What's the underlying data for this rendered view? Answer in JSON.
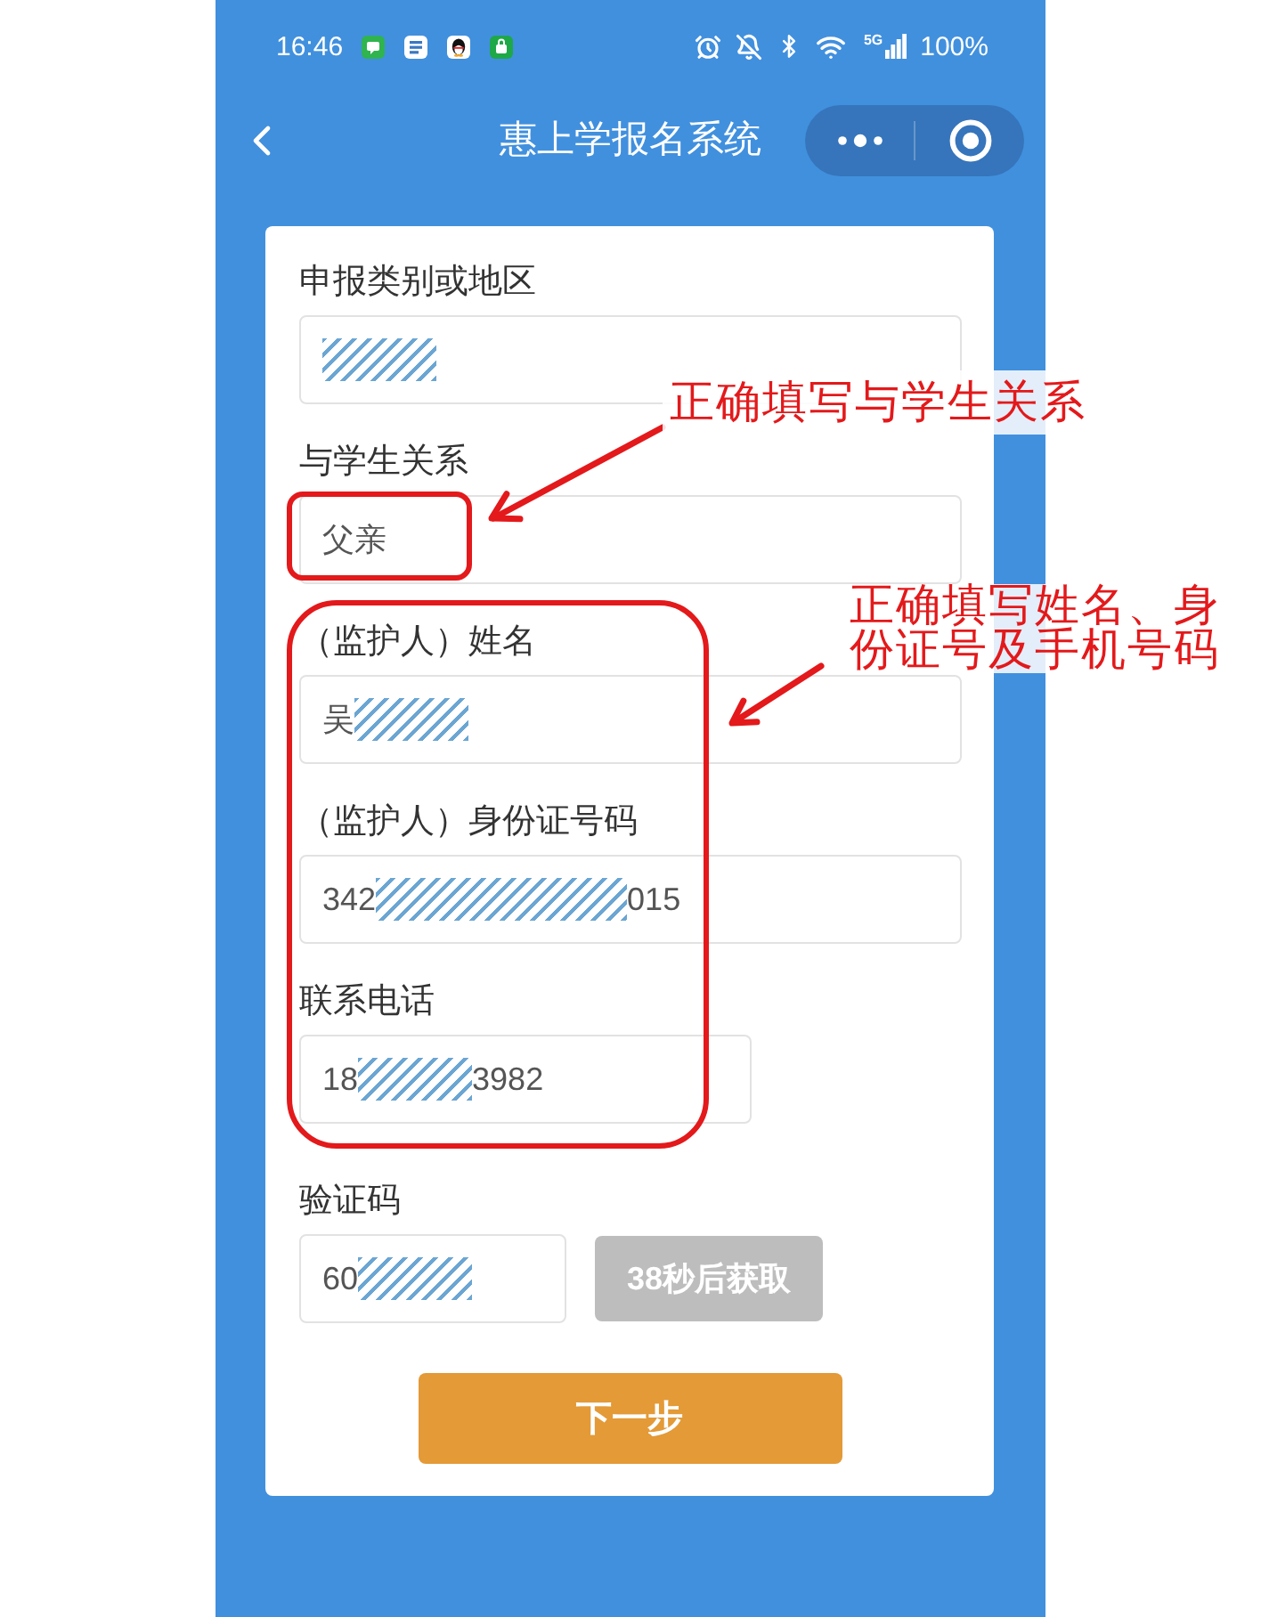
{
  "status_bar": {
    "time": "16:46",
    "network": "5G",
    "battery": "100%"
  },
  "nav_bar": {
    "title": "惠上学报名系统"
  },
  "form": {
    "fields": [
      {
        "kind": "text",
        "label": "申报类别或地区",
        "value": [
          {
            "kind": "mask"
          }
        ]
      },
      {
        "kind": "text",
        "label": "与学生关系",
        "value": [
          {
            "kind": "text",
            "text": "父亲"
          }
        ]
      },
      {
        "kind": "text",
        "label": "（监护人）姓名",
        "value": [
          {
            "kind": "text",
            "text": "吴"
          },
          {
            "kind": "mask"
          }
        ]
      },
      {
        "kind": "text",
        "label": "（监护人）身份证号码",
        "value": [
          {
            "kind": "text",
            "text": "342"
          },
          {
            "kind": "longmask"
          },
          {
            "kind": "text",
            "text": "015"
          }
        ]
      },
      {
        "kind": "phone",
        "label": "联系电话",
        "value": [
          {
            "kind": "text",
            "text": "18"
          },
          {
            "kind": "mask"
          },
          {
            "kind": "text",
            "text": "3982"
          }
        ]
      }
    ],
    "verification": {
      "label": "验证码",
      "value": [
        {
          "kind": "text",
          "text": "60"
        },
        {
          "kind": "mask"
        }
      ],
      "button": {
        "label": "38秒后获取",
        "disabled": true
      }
    },
    "submit": {
      "label": "下一步"
    }
  },
  "annotations": [
    {
      "text": "正确填写与学生关系"
    },
    {
      "text": "正确填写姓名、身份证号及手机号码"
    }
  ]
}
